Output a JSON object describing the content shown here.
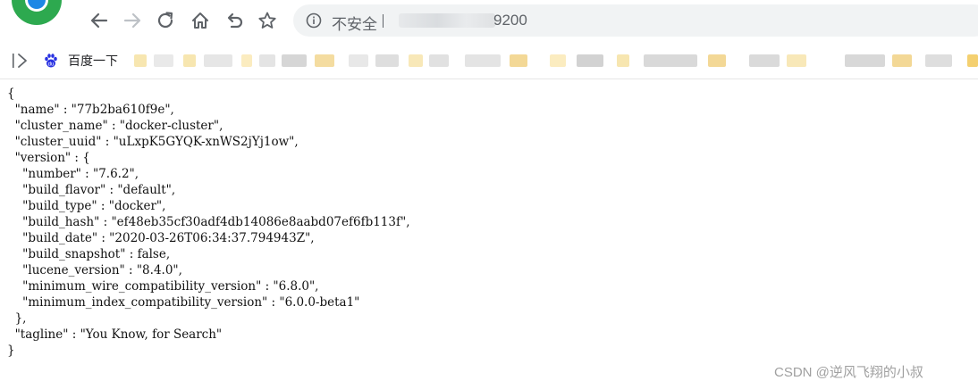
{
  "browser": {
    "security_label": "不安全",
    "url_visible_port": "9200",
    "icons": [
      "chrome-logo-icon",
      "back-arrow-icon",
      "forward-arrow-icon",
      "reload-icon",
      "home-icon",
      "undo-icon",
      "star-icon",
      "info-icon"
    ]
  },
  "bookmarks": {
    "baidu_label": "百度一下",
    "icons": [
      "sidebar-toggle-icon",
      "baidu-paw-icon"
    ]
  },
  "content": {
    "json_text": "{\n  \"name\" : \"77b2ba610f9e\",\n  \"cluster_name\" : \"docker-cluster\",\n  \"cluster_uuid\" : \"uLxpK5GYQK-xnWS2jYj1ow\",\n  \"version\" : {\n    \"number\" : \"7.6.2\",\n    \"build_flavor\" : \"default\",\n    \"build_type\" : \"docker\",\n    \"build_hash\" : \"ef48eb35cf30adf4db14086e8aabd07ef6fb113f\",\n    \"build_date\" : \"2020-03-26T06:34:37.794943Z\",\n    \"build_snapshot\" : false,\n    \"lucene_version\" : \"8.4.0\",\n    \"minimum_wire_compatibility_version\" : \"6.8.0\",\n    \"minimum_index_compatibility_version\" : \"6.0.0-beta1\"\n  },\n  \"tagline\" : \"You Know, for Search\"\n}"
  },
  "watermark": "CSDN @逆风飞翔的小叔"
}
